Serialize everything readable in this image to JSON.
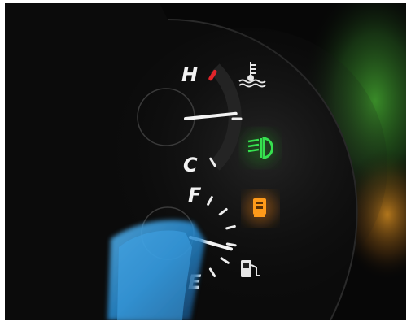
{
  "temperature_gauge": {
    "hot_label": "H",
    "cold_label": "C",
    "needle_level": 0.55
  },
  "fuel_gauge": {
    "full_label": "F",
    "empty_label": "E",
    "needle_level": 0.35
  },
  "indicators": [
    {
      "name": "coolant-temperature-icon",
      "color": "#e8e8e8",
      "lit": false
    },
    {
      "name": "fog-light-icon",
      "color": "#2fd14a",
      "lit": true
    },
    {
      "name": "seat-heater-icon",
      "color": "#ff9a1a",
      "lit": true
    },
    {
      "name": "fuel-pump-icon",
      "color": "#e8e8e8",
      "lit": false
    }
  ],
  "colors": {
    "redline": "#e0242a",
    "needle": "#f4f4f4",
    "glare_blue": "#2a8fd6",
    "glare_green": "#2e7f2a",
    "glare_amber": "#c07a1a"
  }
}
